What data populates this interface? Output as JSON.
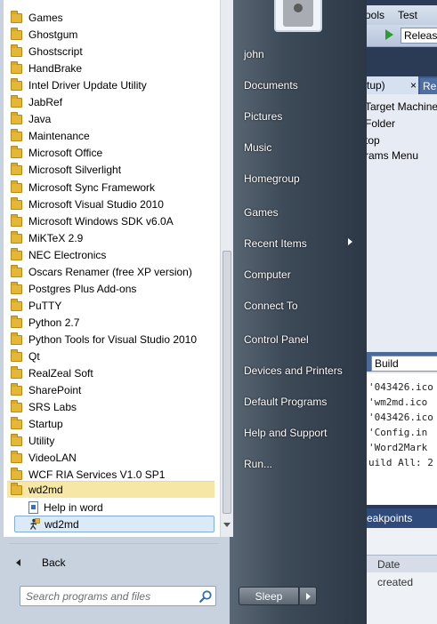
{
  "background_window": {
    "menu": [
      "ools",
      "Test"
    ],
    "config_value": "Releas",
    "tabs": [
      {
        "label": "x(tup)",
        "close": "×"
      },
      {
        "label": "Re"
      }
    ],
    "pane_lines": [
      "Target Machine",
      "Folder",
      "top",
      "rams Menu"
    ],
    "output_dropdown": "Build",
    "output_lines": [
      "'043426.ico",
      "'wm2md.ico",
      "'043426.ico",
      "'Config.in",
      "'Word2Mark",
      "uild All: 2"
    ],
    "breakpoints_tab": "reakpoints",
    "bottom_header": "Date created"
  },
  "programs": {
    "folders": [
      "Games",
      "Ghostgum",
      "Ghostscript",
      "HandBrake",
      "Intel Driver Update Utility",
      "JabRef",
      "Java",
      "Maintenance",
      "Microsoft Office",
      "Microsoft Silverlight",
      "Microsoft Sync Framework",
      "Microsoft Visual Studio 2010",
      "Microsoft Windows SDK v6.0A",
      "MiKTeX 2.9",
      "NEC Electronics",
      "Oscars Renamer (free XP version)",
      "Postgres Plus Add-ons",
      "PuTTY",
      "Python 2.7",
      "Python Tools for Visual Studio 2010",
      "Qt",
      "RealZeal Soft",
      "SharePoint",
      "SRS Labs",
      "Startup",
      "Utility",
      "VideoLAN",
      "WCF RIA Services V1.0 SP1"
    ],
    "open_folder": "wd2md",
    "open_folder_items": [
      {
        "label": "Help in word",
        "icon": "help-document-icon"
      },
      {
        "label": "wd2md",
        "icon": "run-program-icon"
      }
    ]
  },
  "back_label": "Back",
  "search": {
    "placeholder": "Search programs and files"
  },
  "right_panel": {
    "user": "john",
    "links": [
      "Documents",
      "Pictures",
      "Music",
      "Homegroup",
      "Games",
      "Recent Items",
      "Computer",
      "Connect To",
      "Control Panel",
      "Devices and Printers",
      "Default Programs",
      "Help and Support",
      "Run..."
    ],
    "sleep_label": "Sleep"
  },
  "colors": {
    "folder_yellow": "#e4b736",
    "open_folder_highlight": "#f7e7a6",
    "selected_item": "#dce9f7",
    "right_panel_text": "#ffffff"
  }
}
